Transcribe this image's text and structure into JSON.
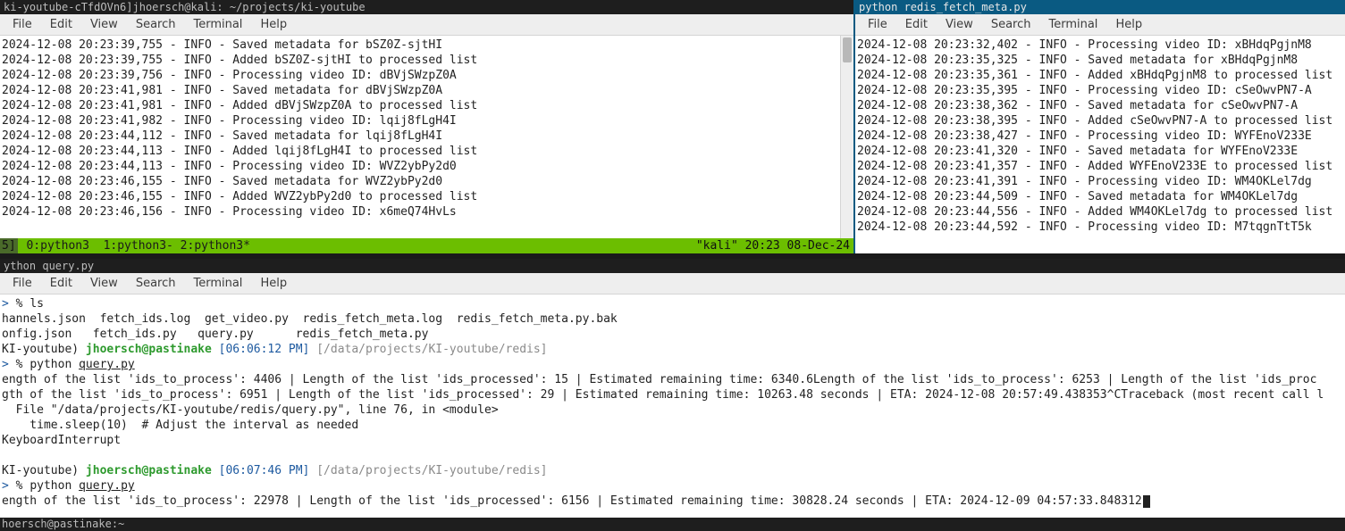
{
  "panes": {
    "tl": {
      "title": "ki-youtube-cTfdOVn6]jhoersch@kali: ~/projects/ki-youtube",
      "menu": [
        "File",
        "Edit",
        "View",
        "Search",
        "Terminal",
        "Help"
      ],
      "log": [
        "2024-12-08 20:23:39,755 - INFO - Saved metadata for bSZ0Z-sjtHI",
        "2024-12-08 20:23:39,755 - INFO - Added bSZ0Z-sjtHI to processed list",
        "2024-12-08 20:23:39,756 - INFO - Processing video ID: dBVjSWzpZ0A",
        "2024-12-08 20:23:41,981 - INFO - Saved metadata for dBVjSWzpZ0A",
        "2024-12-08 20:23:41,981 - INFO - Added dBVjSWzpZ0A to processed list",
        "2024-12-08 20:23:41,982 - INFO - Processing video ID: lqij8fLgH4I",
        "2024-12-08 20:23:44,112 - INFO - Saved metadata for lqij8fLgH4I",
        "2024-12-08 20:23:44,113 - INFO - Added lqij8fLgH4I to processed list",
        "2024-12-08 20:23:44,113 - INFO - Processing video ID: WVZ2ybPy2d0",
        "2024-12-08 20:23:46,155 - INFO - Saved metadata for WVZ2ybPy2d0",
        "2024-12-08 20:23:46,155 - INFO - Added WVZ2ybPy2d0 to processed list",
        "2024-12-08 20:23:46,156 - INFO - Processing video ID: x6meQ74HvLs"
      ],
      "tmux": {
        "session": "5]",
        "windows": " 0:python3  1:python3- 2:python3*",
        "right": "\"kali\" 20:23 08-Dec-24"
      }
    },
    "tr": {
      "title": "python redis_fetch_meta.py",
      "menu": [
        "File",
        "Edit",
        "View",
        "Search",
        "Terminal",
        "Help"
      ],
      "log": [
        "2024-12-08 20:23:32,402 - INFO - Processing video ID: xBHdqPgjnM8",
        "2024-12-08 20:23:35,325 - INFO - Saved metadata for xBHdqPgjnM8",
        "2024-12-08 20:23:35,361 - INFO - Added xBHdqPgjnM8 to processed list",
        "2024-12-08 20:23:35,395 - INFO - Processing video ID: cSeOwvPN7-A",
        "2024-12-08 20:23:38,362 - INFO - Saved metadata for cSeOwvPN7-A",
        "2024-12-08 20:23:38,395 - INFO - Added cSeOwvPN7-A to processed list",
        "2024-12-08 20:23:38,427 - INFO - Processing video ID: WYFEnoV233E",
        "2024-12-08 20:23:41,320 - INFO - Saved metadata for WYFEnoV233E",
        "2024-12-08 20:23:41,357 - INFO - Added WYFEnoV233E to processed list",
        "2024-12-08 20:23:41,391 - INFO - Processing video ID: WM4OKLel7dg",
        "2024-12-08 20:23:44,509 - INFO - Saved metadata for WM4OKLel7dg",
        "2024-12-08 20:23:44,556 - INFO - Added WM4OKLel7dg to processed list",
        "2024-12-08 20:23:44,592 - INFO - Processing video ID: M7tqgnTtT5k"
      ]
    },
    "b": {
      "title": "ython query.py",
      "menu": [
        "File",
        "Edit",
        "View",
        "Search",
        "Terminal",
        "Help"
      ],
      "content": {
        "l0_arrow": "> ",
        "l0_pct": "% ",
        "l0_cmd": "ls",
        "l1": "hannels.json  fetch_ids.log  get_video.py  redis_fetch_meta.log  redis_fetch_meta.py.bak",
        "l2": "onfig.json   fetch_ids.py   query.py      redis_fetch_meta.py",
        "l3_env": "KI-youtube) ",
        "l3_user": "jhoersch@pastinake ",
        "l3_time": "[06:06:12 PM]",
        "l3_path": " [/data/projects/KI-youtube/redis]",
        "l4_arrow": "> ",
        "l4_pct": "% ",
        "l4_cmd_a": "python ",
        "l4_cmd_b": "query.py",
        "l5": "ength of the list 'ids_to_process': 4406 | Length of the list 'ids_processed': 15 | Estimated remaining time: 6340.6Length of the list 'ids_to_process': 6253 | Length of the list 'ids_proc",
        "l6": "gth of the list 'ids_to_process': 6951 | Length of the list 'ids_processed': 29 | Estimated remaining time: 10263.48 seconds | ETA: 2024-12-08 20:57:49.438353^CTraceback (most recent call l",
        "l7": "  File \"/data/projects/KI-youtube/redis/query.py\", line 76, in <module>",
        "l8": "    time.sleep(10)  # Adjust the interval as needed",
        "l9": "KeyboardInterrupt",
        "l10": "",
        "l11_env": "KI-youtube) ",
        "l11_user": "jhoersch@pastinake ",
        "l11_time": "[06:07:46 PM]",
        "l11_path": " [/data/projects/KI-youtube/redis]",
        "l12_arrow": "> ",
        "l12_pct": "% ",
        "l12_cmd_a": "python ",
        "l12_cmd_b": "query.py",
        "l13": "ength of the list 'ids_to_process': 22978 | Length of the list 'ids_processed': 6156 | Estimated remaining time: 30828.24 seconds | ETA: 2024-12-09 04:57:33.848312"
      }
    }
  },
  "bottom_status": "hoersch@pastinake:~"
}
